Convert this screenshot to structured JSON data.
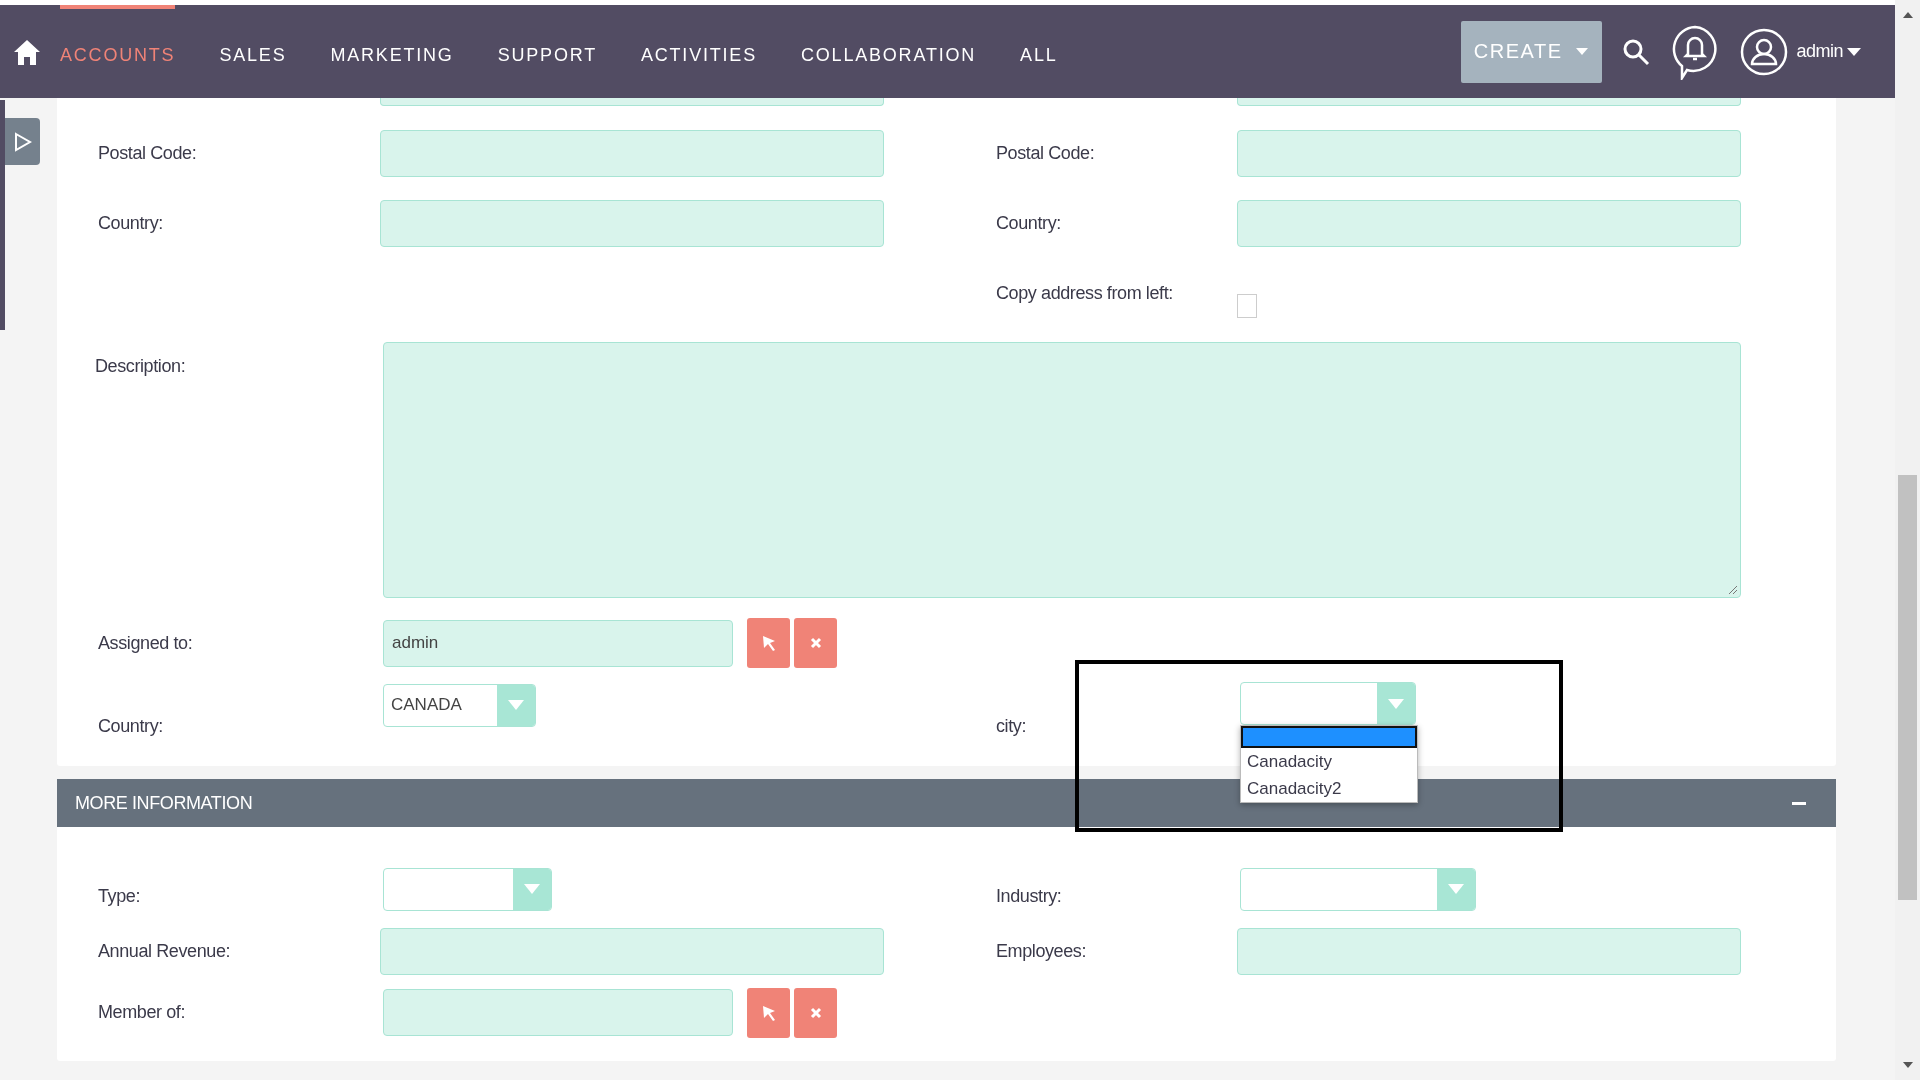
{
  "nav": {
    "items": [
      {
        "label": "ACCOUNTS",
        "selected": true
      },
      {
        "label": "SALES",
        "selected": false
      },
      {
        "label": "MARKETING",
        "selected": false
      },
      {
        "label": "SUPPORT",
        "selected": false
      },
      {
        "label": "ACTIVITIES",
        "selected": false
      },
      {
        "label": "COLLABORATION",
        "selected": false
      },
      {
        "label": "ALL",
        "selected": false
      }
    ],
    "create": "CREATE",
    "user": "admin"
  },
  "rows": [
    {
      "kind": "pair",
      "cells": [
        {
          "label": "Postal Code:",
          "kind": "text"
        },
        {
          "label": "Postal Code:",
          "kind": "text"
        }
      ]
    },
    {
      "kind": "pair",
      "cells": [
        {
          "label": "Country:",
          "kind": "text"
        },
        {
          "label": "Country:",
          "kind": "text"
        }
      ]
    },
    {
      "kind": "pair",
      "cells": [
        {
          "kind": "none"
        },
        {
          "label": "Copy address from left:",
          "kind": "checkbox",
          "checked": false
        }
      ]
    },
    {
      "kind": "wide",
      "cells": [
        {
          "label": "Description:",
          "kind": "textarea"
        }
      ]
    },
    {
      "kind": "pair",
      "cells": [
        {
          "label": "Assigned to:",
          "kind": "relate",
          "value": "admin"
        },
        {
          "kind": "none"
        }
      ]
    },
    {
      "kind": "pair",
      "cells": [
        {
          "label": "Country:",
          "kind": "select",
          "value": "CANADA"
        },
        {
          "label": "city:",
          "kind": "select",
          "open": true,
          "highlighted": true,
          "blank_option": {
            "selected": true
          },
          "options": [
            {
              "label": "Canadacity",
              "selected": false
            },
            {
              "label": "Canadacity2",
              "selected": false
            }
          ]
        }
      ]
    }
  ],
  "more_information": {
    "title": "MORE INFORMATION",
    "expanded": true,
    "rows": [
      {
        "kind": "pair",
        "cells": [
          {
            "label": "Type:",
            "kind": "select"
          },
          {
            "label": "Industry:",
            "kind": "select"
          }
        ]
      },
      {
        "kind": "pair",
        "cells": [
          {
            "label": "Annual Revenue:",
            "kind": "text"
          },
          {
            "label": "Employees:",
            "kind": "text"
          }
        ]
      },
      {
        "kind": "pair",
        "cells": [
          {
            "label": "Member of:",
            "kind": "relate"
          },
          {
            "kind": "none"
          }
        ]
      }
    ]
  }
}
